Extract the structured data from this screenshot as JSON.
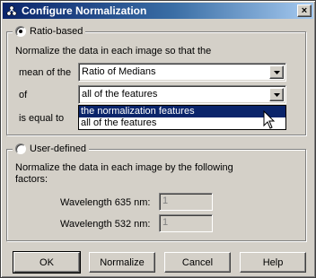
{
  "window": {
    "title": "Configure Normalization",
    "app_icon": "molecule-icon",
    "close_label": "×"
  },
  "ratio_group": {
    "label": "Ratio-based",
    "selected": true,
    "description": "Normalize the data in each image so that the",
    "mean_label": "mean of the",
    "mean_combo": {
      "value": "Ratio of Medians"
    },
    "of_label": "of",
    "of_combo": {
      "value": "all of the features",
      "open": true,
      "options": [
        "the normalization features",
        "all of the features"
      ],
      "highlighted_index": 0
    },
    "equal_label": "is equal to"
  },
  "user_group": {
    "label": "User-defined",
    "selected": false,
    "description_line1": "Normalize the data in each image by the following",
    "description_line2": "factors:",
    "wavelength_635_label": "Wavelength 635 nm:",
    "wavelength_635_value": "1",
    "wavelength_532_label": "Wavelength 532 nm:",
    "wavelength_532_value": "1"
  },
  "buttons": {
    "ok": "OK",
    "normalize": "Normalize",
    "cancel": "Cancel",
    "help": "Help"
  },
  "colors": {
    "face": "#d4d0c8",
    "title_active": "#0a246a",
    "selection": "#0a246a"
  }
}
